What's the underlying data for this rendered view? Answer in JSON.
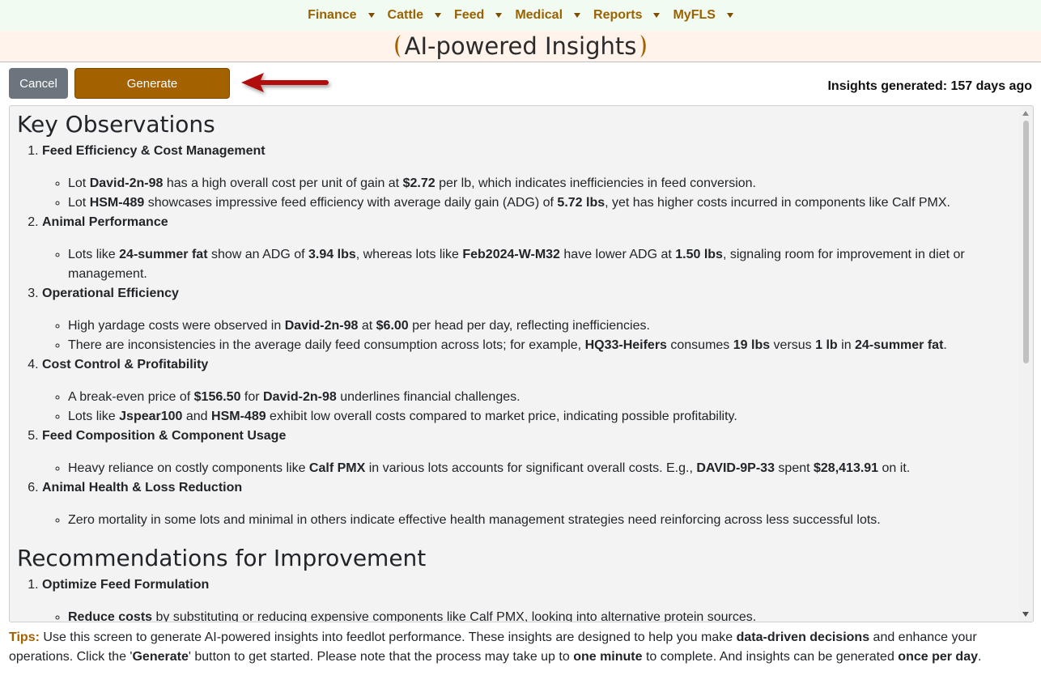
{
  "nav": {
    "items": [
      {
        "label": "Finance"
      },
      {
        "label": "Cattle"
      },
      {
        "label": "Feed"
      },
      {
        "label": "Medical"
      },
      {
        "label": "Reports"
      },
      {
        "label": "MyFLS"
      }
    ]
  },
  "header": {
    "title": "AI-powered Insights"
  },
  "toolbar": {
    "cancel_label": "Cancel",
    "generate_label": "Generate",
    "last_generated": "Insights generated: 157 days ago"
  },
  "insights": {
    "key_heading": "Key Observations",
    "observations": [
      {
        "title": "Feed Efficiency & Cost Management",
        "b1": {
          "t1": "Lot ",
          "b1": "David-2n-98",
          "t2": " has a high overall cost per unit of gain at ",
          "b2": "$2.72",
          "t3": " per lb, which indicates inefficiencies in feed conversion."
        },
        "b2": {
          "t1": "Lot ",
          "b1": "HSM-489",
          "t2": " showcases impressive feed efficiency with average daily gain (ADG) of ",
          "b2": "5.72 lbs",
          "t3": ", yet has higher costs incurred in components like Calf PMX."
        }
      },
      {
        "title": "Animal Performance",
        "b1": {
          "t1": "Lots like ",
          "b1": "24-summer fat",
          "t2": " show an ADG of ",
          "b2": "3.94 lbs",
          "t3": ", whereas lots like ",
          "b3": "Feb2024-W-M32",
          "t4": " have lower ADG at ",
          "b4": "1.50 lbs",
          "t5": ", signaling room for improvement in diet or management."
        }
      },
      {
        "title": "Operational Efficiency",
        "b1": {
          "t1": "High yardage costs were observed in ",
          "b1": "David-2n-98",
          "t2": " at ",
          "b2": "$6.00",
          "t3": " per head per day, reflecting inefficiencies."
        },
        "b2": {
          "t1": "There are inconsistencies in the average daily feed consumption across lots; for example, ",
          "b1": "HQ33-Heifers",
          "t2": " consumes ",
          "b2": "19 lbs",
          "t3": " versus ",
          "b3": "1 lb",
          "t4": " in ",
          "b4": "24-summer fat",
          "t5": "."
        }
      },
      {
        "title": "Cost Control & Profitability",
        "b1": {
          "t1": "A break-even price of ",
          "b1": "$156.50",
          "t2": " for ",
          "b2": "David-2n-98",
          "t3": " underlines financial challenges."
        },
        "b2": {
          "t1": "Lots like ",
          "b1": "Jspear100",
          "t2": " and ",
          "b2": "HSM-489",
          "t3": " exhibit low overall costs compared to market price, indicating possible profitability."
        }
      },
      {
        "title": "Feed Composition & Component Usage",
        "b1": {
          "t1": "Heavy reliance on costly components like ",
          "b1": "Calf PMX",
          "t2": " in various lots accounts for significant overall costs. E.g., ",
          "b2": "DAVID-9P-33",
          "t3": " spent ",
          "b3": "$28,413.91",
          "t4": " on it."
        }
      },
      {
        "title": "Animal Health & Loss Reduction",
        "b1": {
          "t1": "Zero mortality in some lots and minimal in others indicate effective health management strategies need reinforcing across less successful lots."
        }
      }
    ],
    "rec_heading": "Recommendations for Improvement",
    "recommendations": [
      {
        "title": "Optimize Feed Formulation",
        "b1": {
          "b1": "Reduce costs",
          "t1": " by substituting or reducing expensive components like Calf PMX, looking into alternative protein sources."
        }
      }
    ]
  },
  "tips": {
    "label": "Tips:",
    "t1": " Use this screen to generate AI-powered insights into feedlot performance. These insights are designed to help you make ",
    "b1": "data-driven decisions",
    "t2": " and enhance your operations. Click the '",
    "b2": "Generate",
    "t3": "' button to get started. Please note that the process may take up to ",
    "b3": "one minute",
    "t4": " to complete. And insights can be generated ",
    "b4": "once per day",
    "t5": "."
  },
  "colors": {
    "brand": "#a46100",
    "nav_bg": "#f1fbf2",
    "title_bg": "#fff3ec",
    "arrow": "#b10f0f"
  }
}
